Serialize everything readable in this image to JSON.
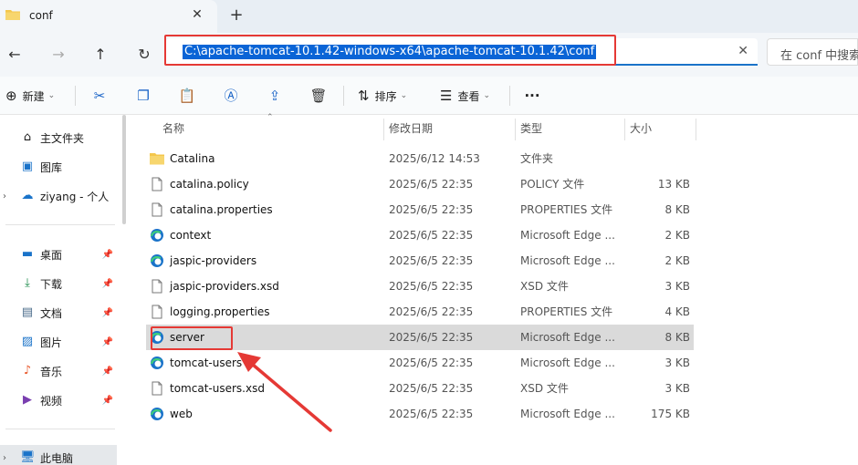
{
  "tab": {
    "title": "conf",
    "close": "✕",
    "add": "+"
  },
  "nav": {
    "back": "←",
    "forward": "→",
    "up": "↑",
    "refresh": "↻"
  },
  "address": {
    "path": "C:\\apache-tomcat-10.1.42-windows-x64\\apache-tomcat-10.1.42\\conf",
    "clear": "✕"
  },
  "search": {
    "placeholder": "在 conf 中搜索"
  },
  "toolbar": {
    "new_label": "新建",
    "sort_label": "排序",
    "view_label": "查看",
    "more": "···"
  },
  "sidebar": {
    "items": [
      {
        "label": "主文件夹",
        "icon": "home-icon"
      },
      {
        "label": "图库",
        "icon": "gallery-icon"
      },
      {
        "label": "ziyang - 个人",
        "icon": "onedrive-cloud-icon"
      },
      {
        "label": "桌面",
        "icon": "desktop-icon"
      },
      {
        "label": "下载",
        "icon": "download-icon"
      },
      {
        "label": "文档",
        "icon": "documents-icon"
      },
      {
        "label": "图片",
        "icon": "pictures-icon"
      },
      {
        "label": "音乐",
        "icon": "music-icon"
      },
      {
        "label": "视频",
        "icon": "videos-icon"
      },
      {
        "label": "此电脑",
        "icon": "this-pc-icon"
      }
    ]
  },
  "columns": {
    "name": "名称",
    "date": "修改日期",
    "type": "类型",
    "size": "大小"
  },
  "files": [
    {
      "name": "Catalina",
      "date": "2025/6/12 14:53",
      "type": "文件夹",
      "size": "",
      "icon": "folder-icon"
    },
    {
      "name": "catalina.policy",
      "date": "2025/6/5 22:35",
      "type": "POLICY 文件",
      "size": "13 KB",
      "icon": "file-icon"
    },
    {
      "name": "catalina.properties",
      "date": "2025/6/5 22:35",
      "type": "PROPERTIES 文件",
      "size": "8 KB",
      "icon": "file-icon"
    },
    {
      "name": "context",
      "date": "2025/6/5 22:35",
      "type": "Microsoft Edge ...",
      "size": "2 KB",
      "icon": "edge-icon"
    },
    {
      "name": "jaspic-providers",
      "date": "2025/6/5 22:35",
      "type": "Microsoft Edge ...",
      "size": "2 KB",
      "icon": "edge-icon"
    },
    {
      "name": "jaspic-providers.xsd",
      "date": "2025/6/5 22:35",
      "type": "XSD 文件",
      "size": "3 KB",
      "icon": "file-icon"
    },
    {
      "name": "logging.properties",
      "date": "2025/6/5 22:35",
      "type": "PROPERTIES 文件",
      "size": "4 KB",
      "icon": "file-icon"
    },
    {
      "name": "server",
      "date": "2025/6/5 22:35",
      "type": "Microsoft Edge ...",
      "size": "8 KB",
      "icon": "edge-icon"
    },
    {
      "name": "tomcat-users",
      "date": "2025/6/5 22:35",
      "type": "Microsoft Edge ...",
      "size": "3 KB",
      "icon": "edge-icon"
    },
    {
      "name": "tomcat-users.xsd",
      "date": "2025/6/5 22:35",
      "type": "XSD 文件",
      "size": "3 KB",
      "icon": "file-icon"
    },
    {
      "name": "web",
      "date": "2025/6/5 22:35",
      "type": "Microsoft Edge ...",
      "size": "175 KB",
      "icon": "edge-icon"
    }
  ],
  "colors": {
    "accent": "#0a64d6",
    "annotation": "#e53935",
    "selected_row": "#dadada",
    "folder": "#f4c74c",
    "edge": "#1a73c9"
  }
}
